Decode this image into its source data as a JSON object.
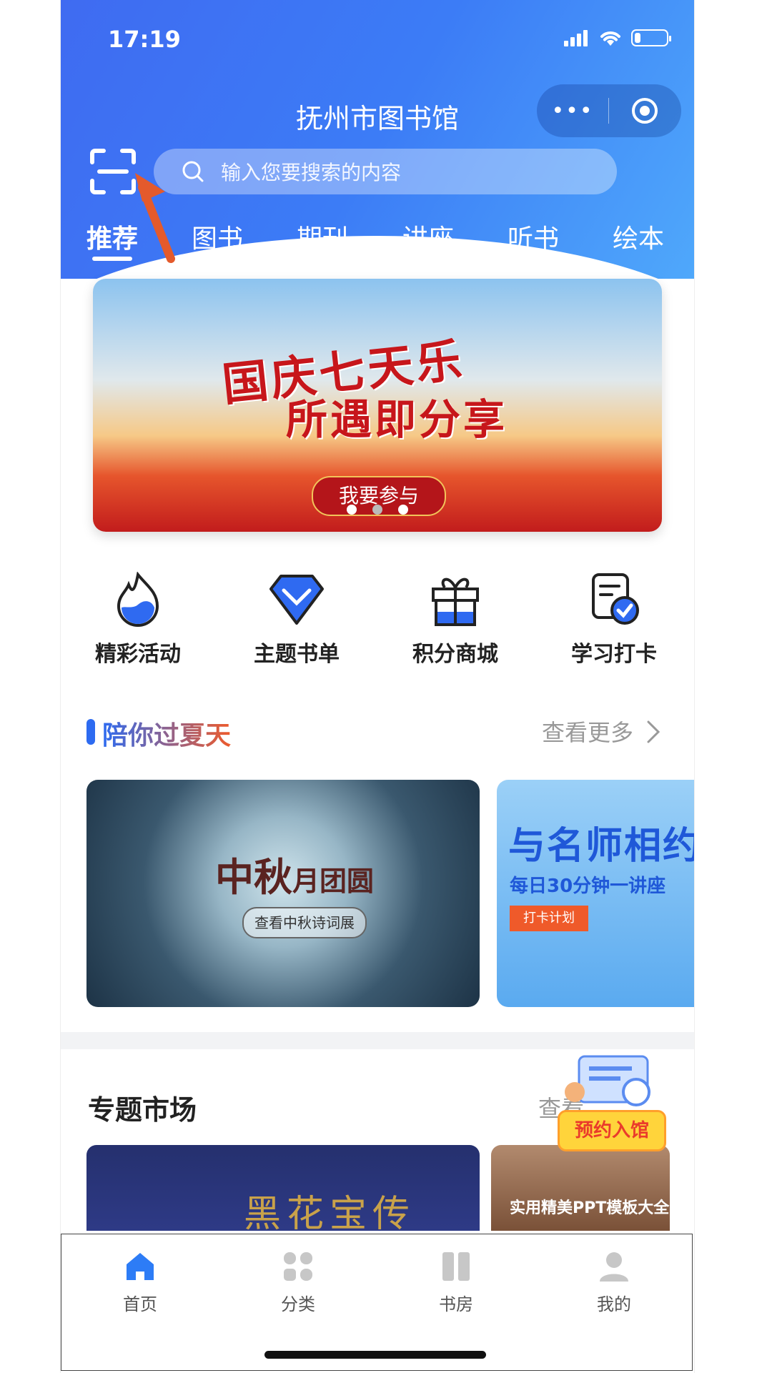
{
  "status_bar": {
    "time": "17:19",
    "battery_level": 0.2
  },
  "header": {
    "title": "抚州市图书馆",
    "capsule_more": "•••",
    "search_placeholder": "输入您要搜索的内容"
  },
  "tabs": [
    {
      "label": "推荐",
      "active": true
    },
    {
      "label": "图书",
      "active": false
    },
    {
      "label": "期刊",
      "active": false
    },
    {
      "label": "讲座",
      "active": false
    },
    {
      "label": "听书",
      "active": false
    },
    {
      "label": "绘本",
      "active": false
    }
  ],
  "banner": {
    "line1": "国庆七天乐",
    "line2": "所遇即分享",
    "button": "我要参与",
    "slide_count": 3,
    "active_slide": 2
  },
  "shortcuts": [
    {
      "label": "精彩活动",
      "icon": "flame-icon"
    },
    {
      "label": "主题书单",
      "icon": "diamond-icon"
    },
    {
      "label": "积分商城",
      "icon": "gift-icon"
    },
    {
      "label": "学习打卡",
      "icon": "checkin-icon"
    }
  ],
  "section1": {
    "title": "陪你过夏天",
    "more": "查看更多",
    "card_a": {
      "title_big": "中秋",
      "title_small": "月团圆",
      "subtitle": "查看中秋诗词展"
    },
    "card_b": {
      "title": "与名师相约",
      "subtitle": "每日30分钟一讲座",
      "button": "打卡计划"
    }
  },
  "section2": {
    "title": "专题市场",
    "more": "查看",
    "card_c_text": "黑花宝传",
    "card_d_text": "实用精美PPT模板大全"
  },
  "floating_badge": {
    "label": "预约入馆"
  },
  "tabbar": [
    {
      "label": "首页",
      "icon": "home-icon",
      "active": true
    },
    {
      "label": "分类",
      "icon": "category-icon",
      "active": false
    },
    {
      "label": "书房",
      "icon": "bookshelf-icon",
      "active": false
    },
    {
      "label": "我的",
      "icon": "profile-icon",
      "active": false
    }
  ],
  "colors": {
    "primary": "#3f6bf1",
    "accent": "#2d6bf1",
    "badge_yellow": "#ffd43b",
    "badge_red": "#ea3b2b"
  }
}
